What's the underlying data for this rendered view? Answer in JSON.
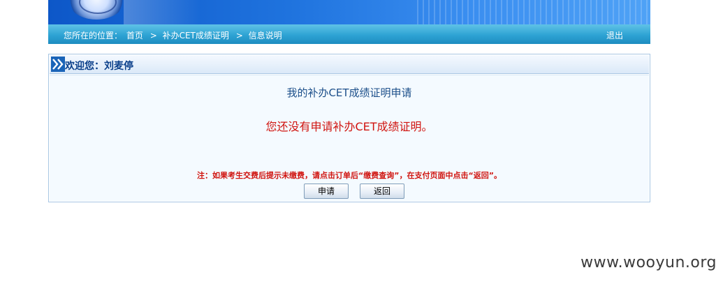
{
  "nav": {
    "location_label": "您所在的位置：",
    "crumbs": [
      "首页",
      "补办CET成绩证明",
      "信息说明"
    ],
    "separator": ">",
    "logout": "退出"
  },
  "panel": {
    "welcome": "欢迎您：刘麦停",
    "title": "我的补办CET成绩证明申请",
    "status": "您还没有申请补办CET成绩证明。",
    "note": "注：如果考生交费后提示未缴费，请点击订单后“缴费查询”，在支付页面中点击“返回”。",
    "buttons": {
      "apply": "申请",
      "back": "返回"
    }
  },
  "watermark": "www.wooyun.org",
  "colors": {
    "banner": "#1f73de",
    "navbar": "#2ea3d4",
    "accent_red": "#d0140f",
    "title_blue": "#1c4f8a",
    "panel_border": "#a9c7e4"
  },
  "icons": {
    "header_marker": "double-chevron-right-icon",
    "logo": "university-emblem-icon"
  }
}
